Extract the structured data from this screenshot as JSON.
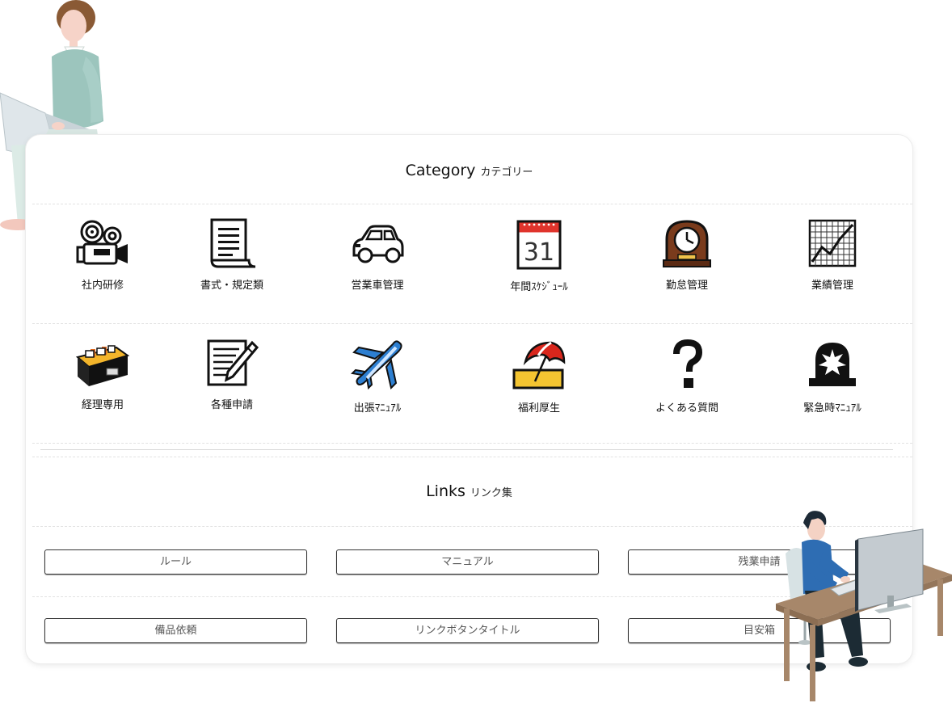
{
  "category": {
    "title_en": "Category",
    "title_jp": "カテゴリー",
    "items": [
      {
        "label": "社内研修",
        "icon": "movie-camera-icon"
      },
      {
        "label": "書式・規定類",
        "icon": "document-icon"
      },
      {
        "label": "営業車管理",
        "icon": "car-icon"
      },
      {
        "label": "年間ｽｹｼﾞｭｰﾙ",
        "icon": "calendar-icon",
        "calendar_day": "31"
      },
      {
        "label": "勤怠管理",
        "icon": "clock-icon"
      },
      {
        "label": "業績管理",
        "icon": "chart-icon"
      },
      {
        "label": "経理専用",
        "icon": "file-box-icon"
      },
      {
        "label": "各種申請",
        "icon": "memo-pencil-icon"
      },
      {
        "label": "出張ﾏﾆｭｱﾙ",
        "icon": "airplane-icon"
      },
      {
        "label": "福利厚生",
        "icon": "beach-umbrella-icon"
      },
      {
        "label": "よくある質問",
        "icon": "question-mark-icon"
      },
      {
        "label": "緊急時ﾏﾆｭｱﾙ",
        "icon": "siren-icon"
      }
    ]
  },
  "links": {
    "title_en": "Links",
    "title_jp": "リンク集",
    "buttons": [
      {
        "label": "ルール"
      },
      {
        "label": "マニュアル"
      },
      {
        "label": "残業申請"
      },
      {
        "label": "備品依頼"
      },
      {
        "label": "リンクボタンタイトル"
      },
      {
        "label": "目安箱"
      }
    ]
  },
  "colors": {
    "calendar_red": "#e0342c",
    "clock_brown": "#7a3b1c",
    "box_yellow": "#f3b52b",
    "plane_blue": "#2d7fd1",
    "umbrella_red": "#d9261c",
    "sand_yellow": "#f4c431",
    "laptop_woman_shirt": "#9cc5bd",
    "man_shirt": "#2e6db3",
    "desk_brown": "#a7876a"
  }
}
